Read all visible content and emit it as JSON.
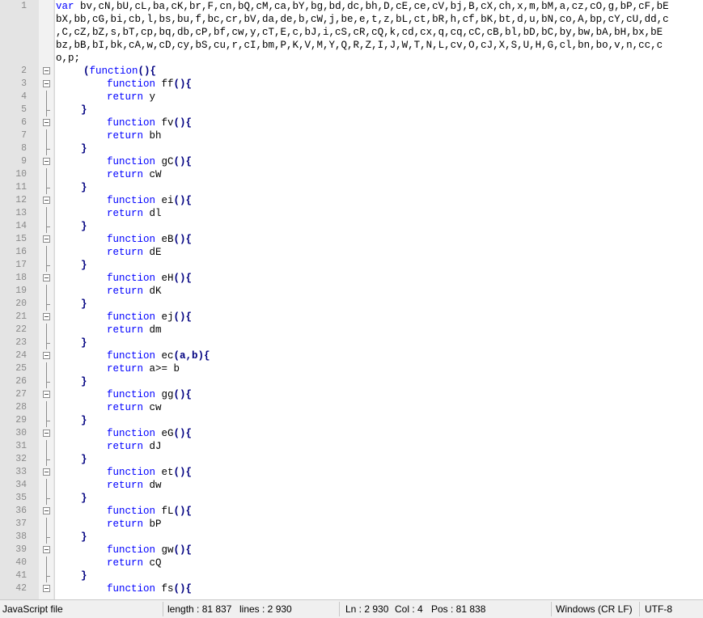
{
  "editor": {
    "line1": {
      "number": "1",
      "keyword": "var",
      "wrapped": [
        " bv,cN,bU,cL,ba,cK,br,F,cn,bQ,cM,ca,bY,bg,bd,dc,bh,D,cE,ce,cV,bj,B,cX,ch,x,m,bM,a,cz,cO,g,bP,cF,bE",
        "bX,bb,cG,bi,cb,l,bs,bu,f,bc,cr,bV,da,de,b,cW,j,be,e,t,z,bL,ct,bR,h,cf,bK,bt,d,u,bN,co,A,bp,cY,cU,dd,c",
        ",C,cZ,bZ,s,bT,cp,bq,db,cP,bf,cw,y,cT,E,c,bJ,i,cS,cR,cQ,k,cd,cx,q,cq,cC,cB,bl,bD,bC,by,bw,bA,bH,bx,bE",
        "bz,bB,bI,bk,cA,w,cD,cy,bS,cu,r,cI,bm,P,K,V,M,Y,Q,R,Z,I,J,W,T,N,L,cv,O,cJ,X,S,U,H,G,cl,bn,bo,v,n,cc,c",
        "o,p;"
      ]
    },
    "iife_open": {
      "number": "2",
      "open": "(",
      "keyword": "function",
      "close": "(){"
    },
    "functions": [
      {
        "decl_ln": "3",
        "ret_ln": "4",
        "close_ln": "5",
        "keyword": "function",
        "name": "ff",
        "params": "(){",
        "return_kw": "return",
        "ret": "y",
        "close": "}"
      },
      {
        "decl_ln": "6",
        "ret_ln": "7",
        "close_ln": "8",
        "keyword": "function",
        "name": "fv",
        "params": "(){",
        "return_kw": "return",
        "ret": "bh",
        "close": "}"
      },
      {
        "decl_ln": "9",
        "ret_ln": "10",
        "close_ln": "11",
        "keyword": "function",
        "name": "gC",
        "params": "(){",
        "return_kw": "return",
        "ret": "cW",
        "close": "}"
      },
      {
        "decl_ln": "12",
        "ret_ln": "13",
        "close_ln": "14",
        "keyword": "function",
        "name": "ei",
        "params": "(){",
        "return_kw": "return",
        "ret": "dl",
        "close": "}"
      },
      {
        "decl_ln": "15",
        "ret_ln": "16",
        "close_ln": "17",
        "keyword": "function",
        "name": "eB",
        "params": "(){",
        "return_kw": "return",
        "ret": "dE",
        "close": "}"
      },
      {
        "decl_ln": "18",
        "ret_ln": "19",
        "close_ln": "20",
        "keyword": "function",
        "name": "eH",
        "params": "(){",
        "return_kw": "return",
        "ret": "dK",
        "close": "}"
      },
      {
        "decl_ln": "21",
        "ret_ln": "22",
        "close_ln": "23",
        "keyword": "function",
        "name": "ej",
        "params": "(){",
        "return_kw": "return",
        "ret": "dm",
        "close": "}"
      },
      {
        "decl_ln": "24",
        "ret_ln": "25",
        "close_ln": "26",
        "keyword": "function",
        "name": "ec",
        "params": "(a,b){",
        "return_kw": "return",
        "ret": "a>= b",
        "close": "}"
      },
      {
        "decl_ln": "27",
        "ret_ln": "28",
        "close_ln": "29",
        "keyword": "function",
        "name": "gg",
        "params": "(){",
        "return_kw": "return",
        "ret": "cw",
        "close": "}"
      },
      {
        "decl_ln": "30",
        "ret_ln": "31",
        "close_ln": "32",
        "keyword": "function",
        "name": "eG",
        "params": "(){",
        "return_kw": "return",
        "ret": "dJ",
        "close": "}"
      },
      {
        "decl_ln": "33",
        "ret_ln": "34",
        "close_ln": "35",
        "keyword": "function",
        "name": "et",
        "params": "(){",
        "return_kw": "return",
        "ret": "dw",
        "close": "}"
      },
      {
        "decl_ln": "36",
        "ret_ln": "37",
        "close_ln": "38",
        "keyword": "function",
        "name": "fL",
        "params": "(){",
        "return_kw": "return",
        "ret": "bP",
        "close": "}"
      },
      {
        "decl_ln": "39",
        "ret_ln": "40",
        "close_ln": "41",
        "keyword": "function",
        "name": "gw",
        "params": "(){",
        "return_kw": "return",
        "ret": "cQ",
        "close": "}"
      },
      {
        "decl_ln": "42",
        "keyword": "function",
        "name": "fs",
        "params": "(){"
      }
    ],
    "colors": {
      "keyword": "#0000ff",
      "brace": "#000080",
      "line_number": "#8a8a8a",
      "gutter": "#e4e4e4"
    }
  },
  "statusbar": {
    "file_type": "JavaScript file",
    "length": "length : 81 837",
    "lines": "lines : 2 930",
    "cursor_ln": "Ln : 2 930",
    "cursor_col": "Col : 4",
    "cursor_pos": "Pos : 81 838",
    "eol": "Windows (CR LF)",
    "encoding": "UTF-8"
  }
}
